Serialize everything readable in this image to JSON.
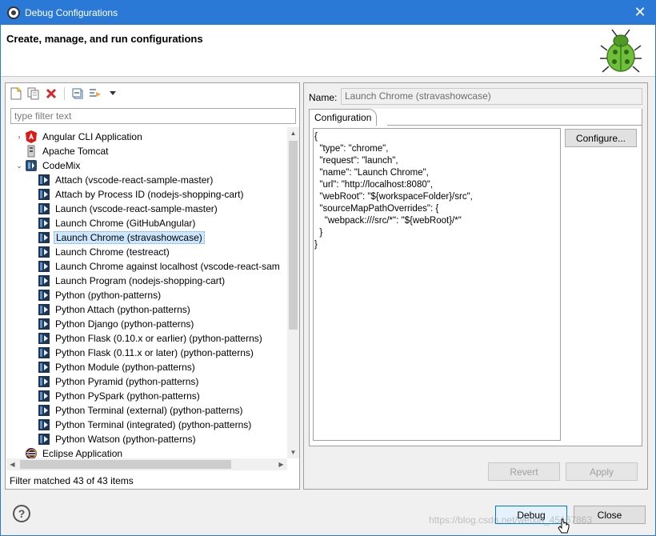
{
  "window": {
    "title": "Debug Configurations",
    "close_glyph": "✕"
  },
  "header": {
    "heading": "Create, manage, and run configurations"
  },
  "left": {
    "filter_placeholder": "type filter text",
    "filter_status": "Filter matched 43 of 43 items",
    "tree": [
      {
        "label": "Angular CLI Application",
        "icon": "angular-icon",
        "level": 0,
        "twisty": "›"
      },
      {
        "label": "Apache Tomcat",
        "icon": "tomcat-icon",
        "level": 0,
        "twisty": ""
      },
      {
        "label": "CodeMix",
        "icon": "codemix-icon",
        "level": 0,
        "twisty": "⌄"
      },
      {
        "label": "Attach (vscode-react-sample-master)",
        "icon": "codemix-config-icon",
        "level": 1
      },
      {
        "label": "Attach by Process ID (nodejs-shopping-cart)",
        "icon": "codemix-config-icon",
        "level": 1
      },
      {
        "label": "Launch (vscode-react-sample-master)",
        "icon": "codemix-config-icon",
        "level": 1
      },
      {
        "label": "Launch Chrome (GitHubAngular)",
        "icon": "codemix-config-icon",
        "level": 1
      },
      {
        "label": "Launch Chrome (stravashowcase)",
        "icon": "codemix-config-icon",
        "level": 1,
        "selected": true
      },
      {
        "label": "Launch Chrome (testreact)",
        "icon": "codemix-config-icon",
        "level": 1
      },
      {
        "label": "Launch Chrome against localhost (vscode-react-sam",
        "icon": "codemix-config-icon",
        "level": 1
      },
      {
        "label": "Launch Program (nodejs-shopping-cart)",
        "icon": "codemix-config-icon",
        "level": 1
      },
      {
        "label": "Python (python-patterns)",
        "icon": "codemix-config-icon",
        "level": 1
      },
      {
        "label": "Python Attach (python-patterns)",
        "icon": "codemix-config-icon",
        "level": 1
      },
      {
        "label": "Python Django (python-patterns)",
        "icon": "codemix-config-icon",
        "level": 1
      },
      {
        "label": "Python Flask (0.10.x or earlier) (python-patterns)",
        "icon": "codemix-config-icon",
        "level": 1
      },
      {
        "label": "Python Flask (0.11.x or later) (python-patterns)",
        "icon": "codemix-config-icon",
        "level": 1
      },
      {
        "label": "Python Module (python-patterns)",
        "icon": "codemix-config-icon",
        "level": 1
      },
      {
        "label": "Python Pyramid (python-patterns)",
        "icon": "codemix-config-icon",
        "level": 1
      },
      {
        "label": "Python PySpark (python-patterns)",
        "icon": "codemix-config-icon",
        "level": 1
      },
      {
        "label": "Python Terminal (external) (python-patterns)",
        "icon": "codemix-config-icon",
        "level": 1
      },
      {
        "label": "Python Terminal (integrated) (python-patterns)",
        "icon": "codemix-config-icon",
        "level": 1
      },
      {
        "label": "Python Watson (python-patterns)",
        "icon": "codemix-config-icon",
        "level": 1
      },
      {
        "label": "Eclipse Application",
        "icon": "eclipse-icon",
        "level": 0,
        "twisty": ""
      }
    ]
  },
  "right": {
    "name_label": "Name:",
    "name_value": "Launch Chrome (stravashowcase)",
    "tab_label": "Configuration",
    "json_text": "{\n  \"type\": \"chrome\",\n  \"request\": \"launch\",\n  \"name\": \"Launch Chrome\",\n  \"url\": \"http://localhost:8080\",\n  \"webRoot\": \"${workspaceFolder}/src\",\n  \"sourceMapPathOverrides\": {\n    \"webpack:///src/*\": \"${webRoot}/*\"\n  }\n}",
    "configure_label": "Configure...",
    "revert_label": "Revert",
    "apply_label": "Apply"
  },
  "footer": {
    "help_glyph": "?",
    "debug_label": "Debug",
    "close_label": "Close",
    "watermark": "https://blog.csdn.net/weixin_45167863"
  }
}
